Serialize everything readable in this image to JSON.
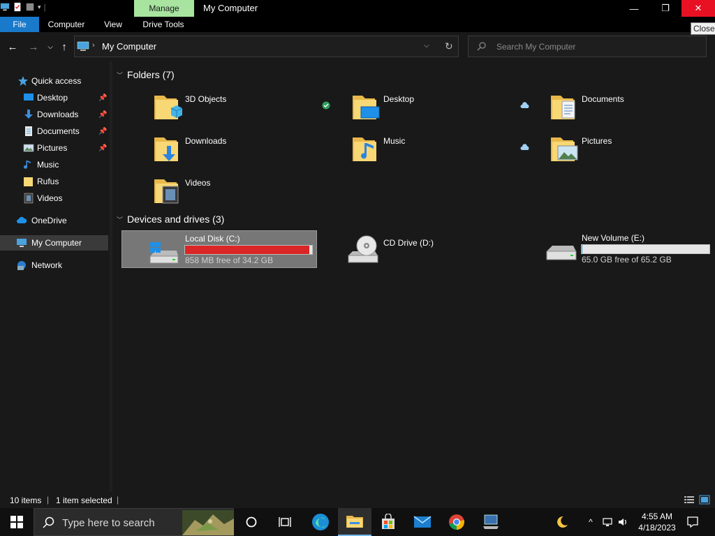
{
  "window": {
    "title": "My Computer",
    "context_tab": "Manage",
    "tooltip": "Close",
    "minimize_glyph": "—",
    "maximize_glyph": "❐",
    "close_glyph": "✕"
  },
  "ribbon": {
    "tabs": [
      {
        "label": "File",
        "active": true
      },
      {
        "label": "Computer"
      },
      {
        "label": "View"
      },
      {
        "label": "Drive Tools"
      }
    ]
  },
  "address_bar": {
    "path": "My Computer",
    "separator": "›",
    "dropdown_glyph": "⌵",
    "refresh_glyph": "↻",
    "back_glyph": "←",
    "forward_glyph": "→",
    "recent_glyph": "⌵",
    "up_glyph": "↑"
  },
  "search": {
    "placeholder": "Search My Computer"
  },
  "sidebar": {
    "pin_glyph": "📌",
    "items": [
      {
        "label": "Quick access",
        "icon": "star-icon"
      },
      {
        "label": "Desktop",
        "icon": "desktop-icon",
        "pinned": true
      },
      {
        "label": "Downloads",
        "icon": "download-icon",
        "pinned": true
      },
      {
        "label": "Documents",
        "icon": "document-icon",
        "pinned": true
      },
      {
        "label": "Pictures",
        "icon": "picture-icon",
        "pinned": true
      },
      {
        "label": "Music",
        "icon": "music-icon"
      },
      {
        "label": "Rufus",
        "icon": "folder-icon"
      },
      {
        "label": "Videos",
        "icon": "video-icon"
      },
      {
        "label": "OneDrive",
        "icon": "cloud-icon"
      },
      {
        "label": "My Computer",
        "icon": "computer-icon",
        "selected": true
      },
      {
        "label": "Network",
        "icon": "network-icon"
      }
    ]
  },
  "groups": {
    "folders_header": "Folders (7)",
    "drives_header": "Devices and drives (3)",
    "folders": [
      {
        "label": "3D Objects"
      },
      {
        "label": "Desktop",
        "status": "synced"
      },
      {
        "label": "Documents",
        "status": "cloud"
      },
      {
        "label": "Downloads"
      },
      {
        "label": "Music"
      },
      {
        "label": "Pictures",
        "status": "cloud"
      },
      {
        "label": "Videos"
      }
    ],
    "drives": [
      {
        "label": "Local Disk (C:)",
        "free_text": "858 MB free of 34.2 GB",
        "used_fraction": 0.976,
        "bar_color": "#da2626",
        "selected": true
      },
      {
        "label": "CD Drive (D:)"
      },
      {
        "label": "New Volume (E:)",
        "free_text": "65.0 GB free of 65.2 GB",
        "used_fraction": 0.003,
        "bar_color": "#26a0da"
      }
    ]
  },
  "statusbar": {
    "item_count": "10 items",
    "selection": "1 item selected",
    "pipe": "|"
  },
  "taskbar": {
    "search_placeholder": "Type here to search",
    "clock_time": "4:55 AM",
    "clock_date": "4/18/2023",
    "chevron_glyph": "^"
  },
  "colors": {
    "accent": "#1979ca",
    "close_red": "#e81123",
    "manage_green": "#a8e4a0",
    "folder_yellow": "#f8d775"
  }
}
